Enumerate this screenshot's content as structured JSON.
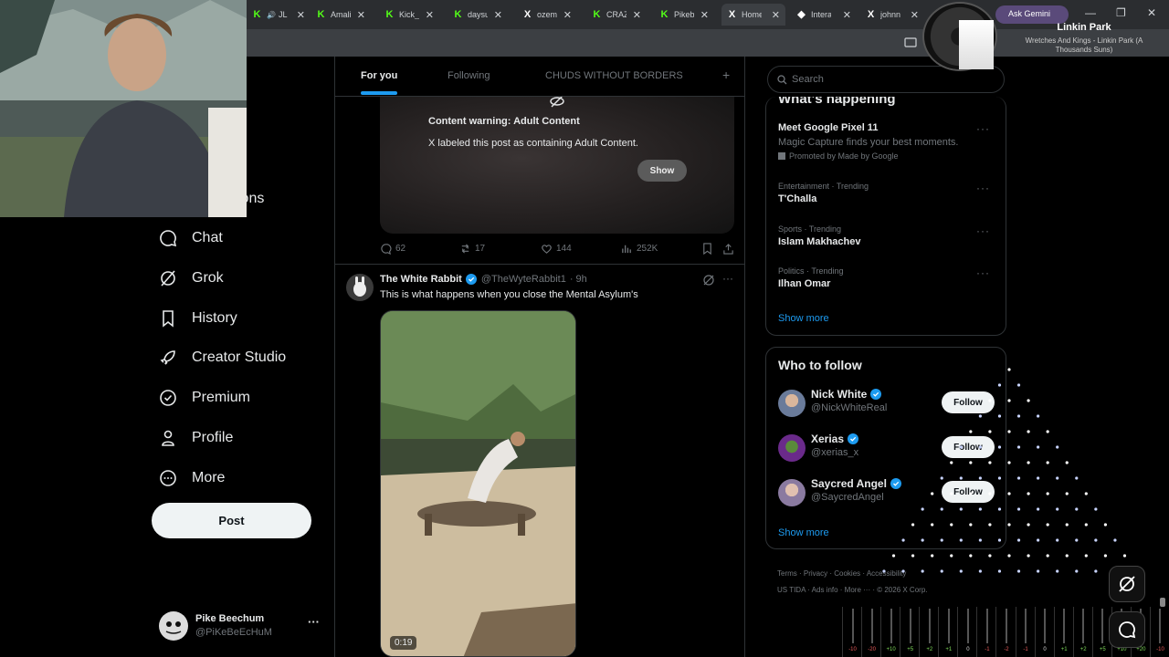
{
  "browser": {
    "tabs": [
      {
        "label": "JL",
        "favicon": "K"
      },
      {
        "label": "Amali",
        "favicon": "K"
      },
      {
        "label": "Kick_",
        "favicon": "K"
      },
      {
        "label": "daysu",
        "favicon": "K"
      },
      {
        "label": "ozem",
        "favicon": "X"
      },
      {
        "label": "CRAZ",
        "favicon": "K"
      },
      {
        "label": "Pikeb",
        "favicon": "K"
      },
      {
        "label": "Home",
        "favicon": "X"
      },
      {
        "label": "Intera",
        "favicon": "◆"
      },
      {
        "label": "johnn",
        "favicon": "X"
      }
    ],
    "window_controls": {
      "restore": "❐",
      "close": "✕"
    }
  },
  "music": {
    "artist": "Linkin Park",
    "track": "Wretches And Kings - Linkin Park (A Thousands Suns)",
    "obscured_tab": "Ask Gemini"
  },
  "nav": {
    "partial_label": "ions",
    "items": [
      {
        "label": "Chat",
        "icon": "chat-icon"
      },
      {
        "label": "Grok",
        "icon": "grok-icon"
      },
      {
        "label": "History",
        "icon": "bookmark-icon"
      },
      {
        "label": "Creator Studio",
        "icon": "rocket-icon"
      },
      {
        "label": "Premium",
        "icon": "verified-badge-icon"
      },
      {
        "label": "Profile",
        "icon": "person-icon"
      },
      {
        "label": "More",
        "icon": "more-circle-icon"
      }
    ],
    "post_label": "Post",
    "account": {
      "name": "Pike Beechum",
      "handle": "@PiKeBeEcHuM",
      "more": "···"
    }
  },
  "feed": {
    "tabs": [
      {
        "label": "For you",
        "active": true
      },
      {
        "label": "Following",
        "active": false
      },
      {
        "label": "CHUDS WITHOUT BORDERS",
        "active": false
      }
    ],
    "add_tab": "+",
    "content_warning": {
      "title": "Content warning: Adult Content",
      "body": "X labeled this post as containing Adult Content.",
      "show_label": "Show"
    },
    "tweet1_stats": {
      "replies": "62",
      "reposts": "17",
      "likes": "144",
      "views": "252K"
    },
    "tweet2": {
      "author": "The White Rabbit",
      "handle": "@TheWyteRabbit1",
      "time": "· 9h",
      "text": "This is what happens when you close the Mental Asylum's",
      "video_duration": "0:19"
    }
  },
  "sidebar": {
    "search_placeholder": "Search",
    "trends_title": "What's happening",
    "trends": [
      {
        "meta": "",
        "name": "Meet Google Pixel 11",
        "desc": "Magic Capture finds your best moments.",
        "promo": "Promoted by Made by Google"
      },
      {
        "meta": "Entertainment · Trending",
        "name": "T'Challa"
      },
      {
        "meta": "Sports · Trending",
        "name": "Islam Makhachev"
      },
      {
        "meta": "Politics · Trending",
        "name": "Ilhan Omar"
      }
    ],
    "show_more": "Show more",
    "wtf_title": "Who to follow",
    "who_to_follow": [
      {
        "name": "Nick White",
        "handle": "@NickWhiteReal",
        "follow": "Follow"
      },
      {
        "name": "Xerias",
        "handle": "@xerias_x",
        "follow": "Follow"
      },
      {
        "name": "Saycred Angel",
        "handle": "@SaycredAngel",
        "follow": "Follow"
      }
    ],
    "wtf_show_more": "Show more",
    "footer": {
      "line1": [
        "Terms",
        "Privacy",
        "Cookies",
        "Accessibility"
      ],
      "line2": [
        "US TIDA",
        "Ads info",
        "More ···",
        "© 2026 X Corp."
      ]
    }
  },
  "mixer": {
    "levels": [
      "-10",
      "-20",
      "+10",
      "+5",
      "+2",
      "+1",
      "0",
      "-1",
      "-2",
      "-1",
      "0",
      "+1",
      "+2",
      "+5",
      "+10",
      "+20",
      "-10"
    ]
  },
  "colors": {
    "accent": "#1d9bf0",
    "bg": "#000000",
    "border": "#2f3336",
    "muted": "#71767b"
  }
}
